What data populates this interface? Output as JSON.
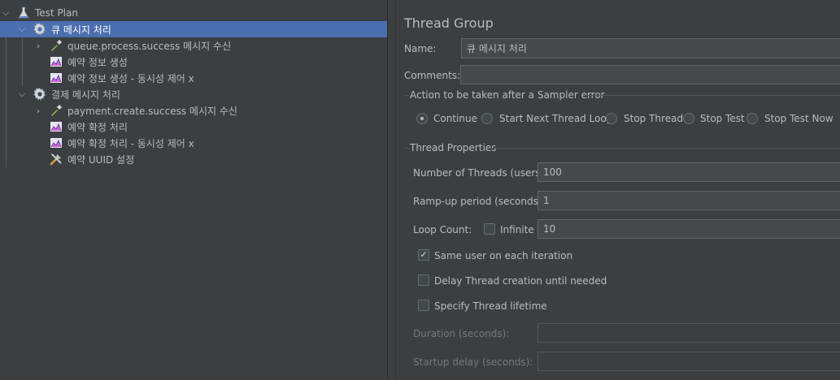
{
  "tree": {
    "items": [
      {
        "label": "Test Plan",
        "icon": "flask-icon"
      },
      {
        "label": "큐 메시지 처리",
        "icon": "gear-icon"
      },
      {
        "label": "queue.process.success 메시지 수신",
        "icon": "pipette-icon"
      },
      {
        "label": "예약 정보 생성",
        "icon": "chart-icon"
      },
      {
        "label": "예약 정보 생성 - 동시성 제어 x",
        "icon": "chart-icon"
      },
      {
        "label": "결제 메시지 처리",
        "icon": "gear-icon"
      },
      {
        "label": "payment.create.success 메시지 수신",
        "icon": "pipette-icon"
      },
      {
        "label": "예약 확정 처리",
        "icon": "chart-icon"
      },
      {
        "label": "예약 확정 처리 - 동시성 제어 x",
        "icon": "chart-icon"
      },
      {
        "label": "예약 UUID 설정",
        "icon": "tools-icon"
      }
    ],
    "selected_index": 1
  },
  "panel": {
    "title": "Thread Group",
    "name_label": "Name:",
    "name_value": "큐 메시지 처리",
    "comments_label": "Comments:",
    "comments_value": "",
    "sampler_error": {
      "legend": "Action to be taken after a Sampler error",
      "options": [
        "Continue",
        "Start Next Thread Loop",
        "Stop Thread",
        "Stop Test",
        "Stop Test Now"
      ],
      "selected": "Continue"
    },
    "thread_props": {
      "legend": "Thread Properties",
      "threads_label": "Number of Threads (users):",
      "threads_value": "100",
      "rampup_label": "Ramp-up period (seconds):",
      "rampup_value": "1",
      "loop_label": "Loop Count:",
      "infinite_label": "Infinite",
      "infinite_checked": false,
      "loop_value": "10",
      "same_user_label": "Same user on each iteration",
      "same_user_checked": true,
      "delay_label": "Delay Thread creation until needed",
      "delay_checked": false,
      "lifetime_label": "Specify Thread lifetime",
      "lifetime_checked": false,
      "duration_label": "Duration (seconds):",
      "duration_value": "",
      "startup_label": "Startup delay (seconds):",
      "startup_value": ""
    }
  },
  "colors": {
    "background": "#3c3f41",
    "selection": "#4b6eaf",
    "text": "#bbbbbb"
  }
}
